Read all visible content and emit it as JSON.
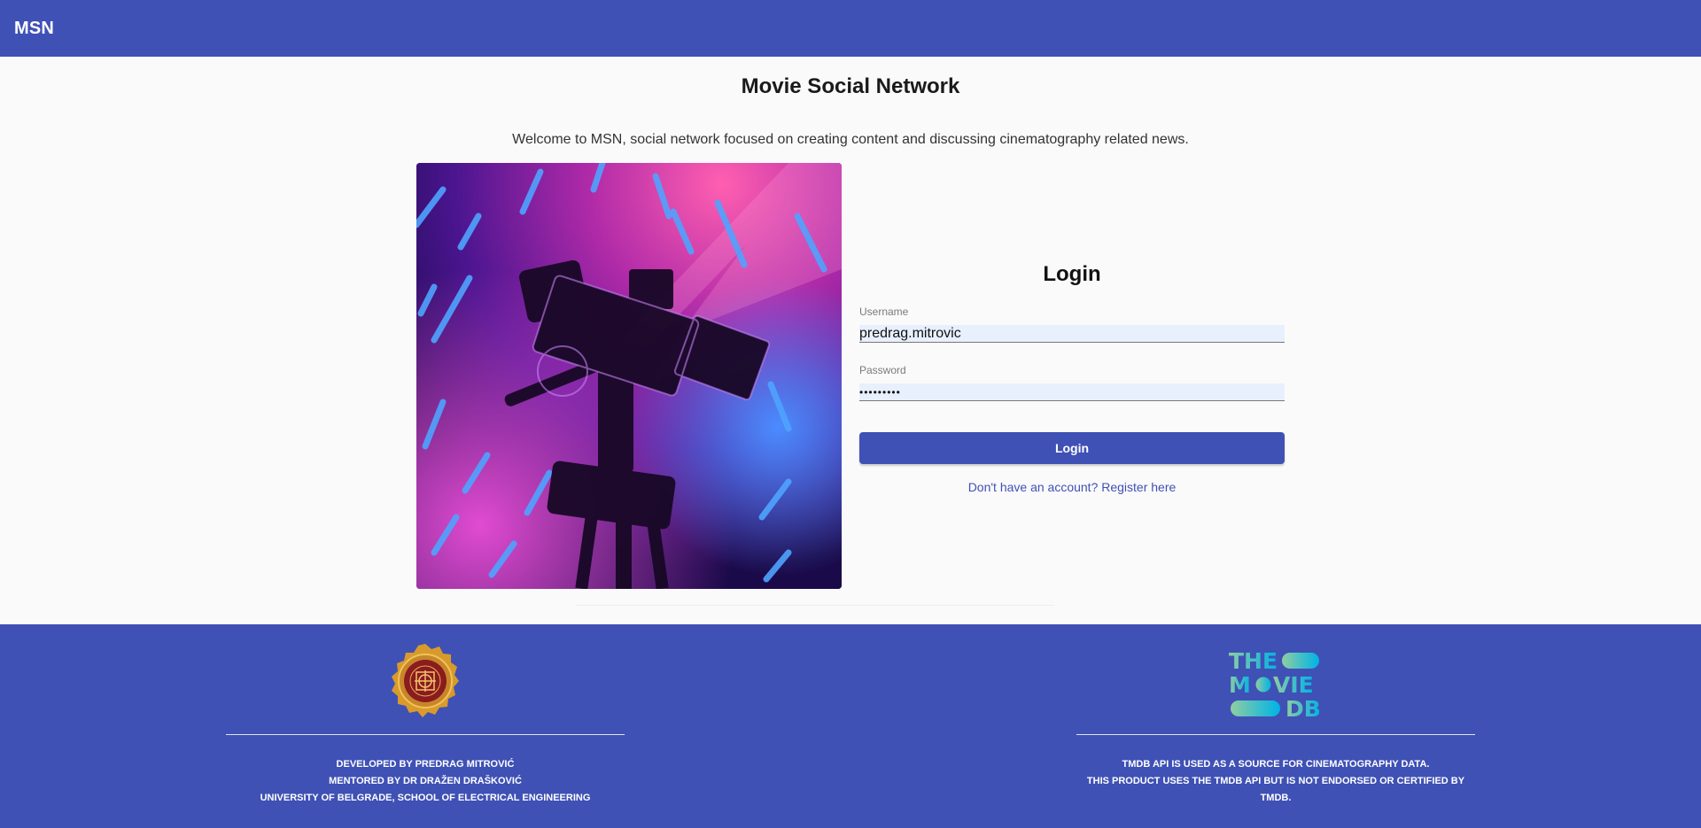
{
  "header": {
    "brand": "MSN"
  },
  "main": {
    "title": "Movie Social Network",
    "welcome": "Welcome to MSN, social network focused on creating content and discussing cinematography related news."
  },
  "login": {
    "title": "Login",
    "username_label": "Username",
    "username_value": "predrag.mitrovic",
    "password_label": "Password",
    "password_value": "•••••••••",
    "button_label": "Login",
    "register_link": "Don't have an account? Register here"
  },
  "footer": {
    "left_lines": [
      "DEVELOPED BY PREDRAG MITROVIĆ",
      "MENTORED BY DR DRAŽEN DRAŠKOVIĆ",
      "UNIVERSITY OF BELGRADE, SCHOOL OF ELECTRICAL ENGINEERING"
    ],
    "right_lines": [
      "TMDB API IS USED AS A SOURCE FOR CINEMATOGRAPHY DATA.",
      "THIS PRODUCT USES THE TMDB API BUT IS NOT ENDORSED OR CERTIFIED BY TMDB."
    ],
    "tmdb_logo": {
      "line1": "THE",
      "line2a": "M",
      "line2b": "VIE",
      "line3": "DB"
    }
  },
  "colors": {
    "primary": "#3f51b5",
    "background": "#fafafa",
    "input_fill": "#e8f0fe",
    "tmdb_teal": "#90cea1",
    "tmdb_blue": "#01b4e4"
  },
  "icons": {
    "hero": "cinema-camera-image",
    "seal": "university-seal-logo",
    "tmdb": "tmdb-logo"
  }
}
